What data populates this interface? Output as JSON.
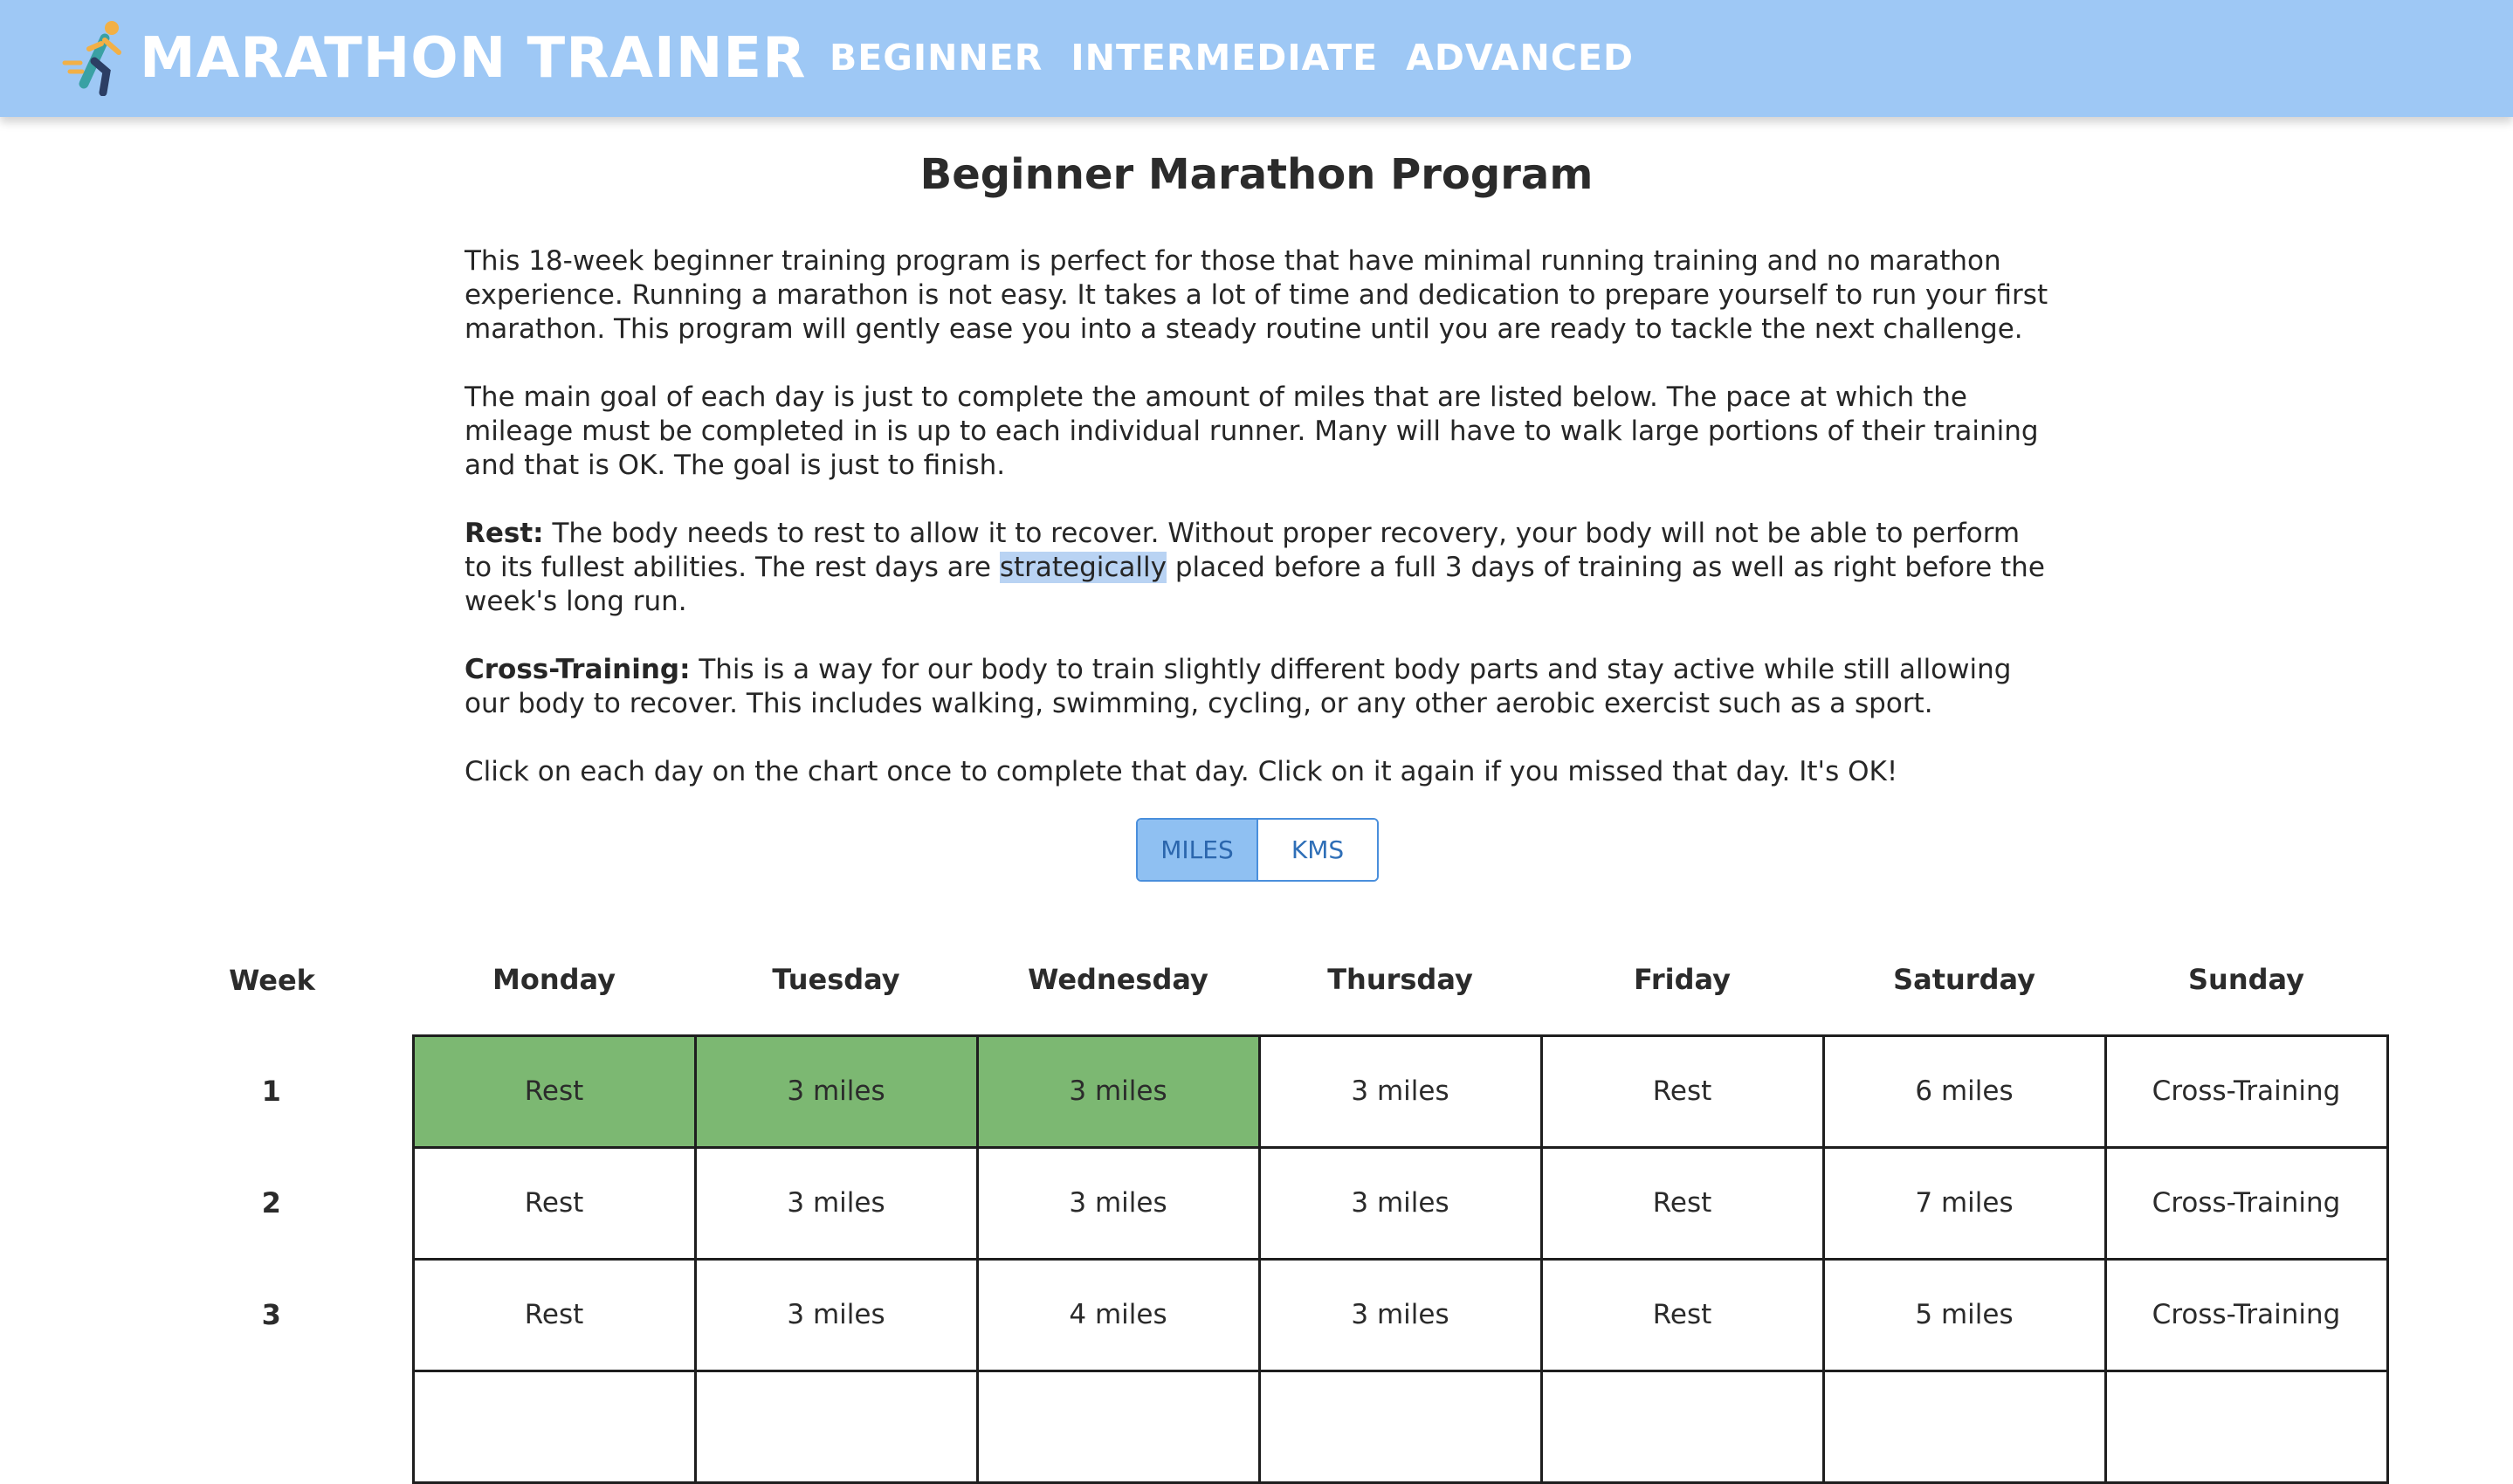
{
  "header": {
    "brand": "MARATHON TRAINER",
    "nav": [
      "BEGINNER",
      "INTERMEDIATE",
      "ADVANCED"
    ],
    "colors": {
      "bar": "#9ec8f5",
      "text": "#ffffff"
    }
  },
  "page": {
    "title": "Beginner Marathon Program",
    "p1": "This 18-week beginner training program is perfect for those that have minimal running training and no marathon experience. Running a marathon is not easy. It takes a lot of time and dedication to prepare yourself to run your first marathon. This program will gently ease you into a steady routine until you are ready to tackle the next challenge.",
    "p2": "The main goal of each day is just to complete the amount of miles that are listed below. The pace at which the mileage must be completed in is up to each individual runner. Many will have to walk large portions of their training and that is OK. The goal is just to finish.",
    "rest_label": "Rest:",
    "rest_text_a": "The body needs to rest to allow it to recover. Without proper recovery, your body will not be able to perform to its fullest abilities. The rest days are",
    "rest_highlight": "strategically",
    "rest_text_b": "placed before a full 3 days of training as well as right before the week's long run.",
    "cross_label": "Cross-Training:",
    "cross_text": "This is a way for our body to train slightly different body parts and stay active while still allowing our body to recover. This includes walking, swimming, cycling, or any other aerobic exercist such as a sport.",
    "p5": "Click on each day on the chart once to complete that day. Click on it again if you missed that day. It's OK!"
  },
  "units": {
    "miles": "MILES",
    "kms": "KMS",
    "selected": "MILES"
  },
  "table": {
    "headers": [
      "Week",
      "Monday",
      "Tuesday",
      "Wednesday",
      "Thursday",
      "Friday",
      "Saturday",
      "Sunday"
    ],
    "done_color": "#7cb872",
    "rows": [
      {
        "week": "1",
        "days": [
          "Rest",
          "3 miles",
          "3 miles",
          "3 miles",
          "Rest",
          "6 miles",
          "Cross-Training"
        ],
        "done": [
          true,
          true,
          true,
          false,
          false,
          false,
          false
        ]
      },
      {
        "week": "2",
        "days": [
          "Rest",
          "3 miles",
          "3 miles",
          "3 miles",
          "Rest",
          "7 miles",
          "Cross-Training"
        ],
        "done": [
          false,
          false,
          false,
          false,
          false,
          false,
          false
        ]
      },
      {
        "week": "3",
        "days": [
          "Rest",
          "3 miles",
          "4 miles",
          "3 miles",
          "Rest",
          "5 miles",
          "Cross-Training"
        ],
        "done": [
          false,
          false,
          false,
          false,
          false,
          false,
          false
        ]
      }
    ]
  }
}
